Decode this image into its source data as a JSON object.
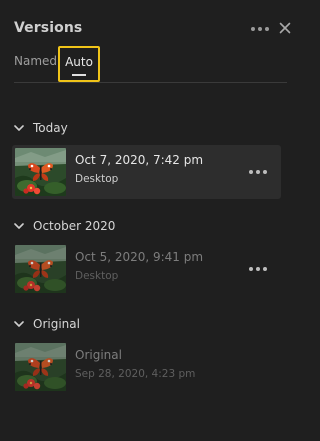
{
  "panel": {
    "title": "Versions",
    "more_icon": "more-horizontal-icon",
    "close_icon": "close-icon"
  },
  "tabs": [
    {
      "label": "Named",
      "selected": false
    },
    {
      "label": "Auto",
      "selected": true
    }
  ],
  "sections": [
    {
      "label": "Today",
      "expanded": true,
      "versions": [
        {
          "date": "Oct 7, 2020, 7:42 pm",
          "source": "Desktop",
          "selected": true
        }
      ]
    },
    {
      "label": "October 2020",
      "expanded": true,
      "versions": [
        {
          "date": "Oct 5, 2020, 9:41 pm",
          "source": "Desktop",
          "selected": false
        }
      ]
    },
    {
      "label": "Original",
      "expanded": true,
      "versions": [
        {
          "date": "Original",
          "source": "Sep 28, 2020, 4:23 pm",
          "selected": false
        }
      ]
    }
  ],
  "colors": {
    "background": "#1f1f1f",
    "selected_row": "#2d2d2d",
    "highlight_box": "#f0c419",
    "text_primary": "#e6e6e6",
    "text_dim": "#7d7d7d"
  }
}
